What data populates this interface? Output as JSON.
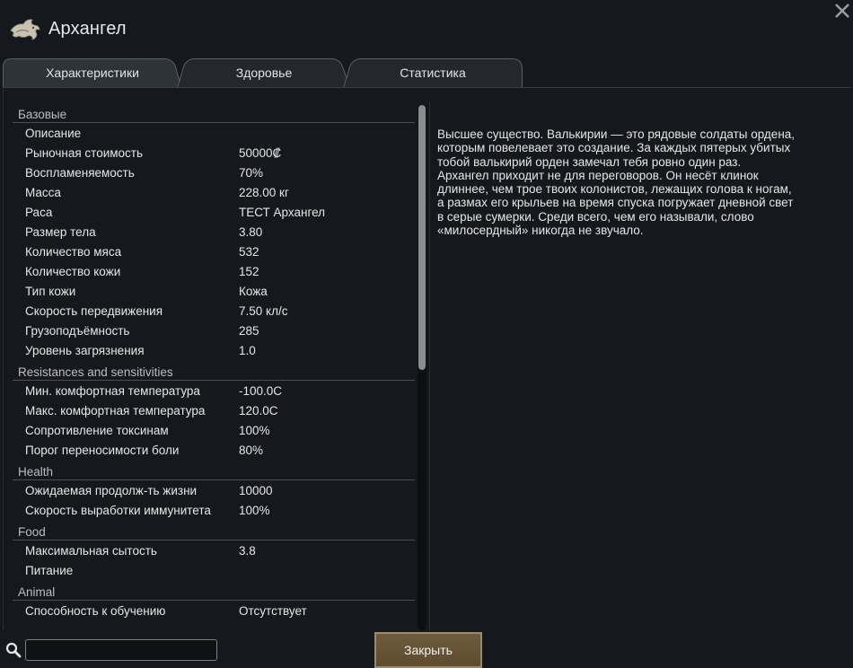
{
  "window": {
    "title": "Архангел",
    "header_icon": "creature-icon",
    "close_icon": "close-icon"
  },
  "tabs": [
    {
      "label": "Характеристики",
      "active": true
    },
    {
      "label": "Здоровье",
      "active": false
    },
    {
      "label": "Статистика",
      "active": false
    }
  ],
  "stats": [
    {
      "category": "Базовые",
      "rows": [
        {
          "label": "Описание",
          "value": ""
        },
        {
          "label": "Рыночная стоимость",
          "value": "50000₡"
        },
        {
          "label": "Воспламеняемость",
          "value": "70%"
        },
        {
          "label": "Масса",
          "value": "228.00 кг"
        },
        {
          "label": "Раса",
          "value": "ТЕСТ Архангел"
        },
        {
          "label": "Размер тела",
          "value": "3.80"
        },
        {
          "label": "Количество мяса",
          "value": "532"
        },
        {
          "label": "Количество кожи",
          "value": "152"
        },
        {
          "label": "Тип кожи",
          "value": "Кожа"
        },
        {
          "label": "Скорость передвижения",
          "value": "7.50 кл/с"
        },
        {
          "label": "Грузоподъёмность",
          "value": "285"
        },
        {
          "label": "Уровень загрязнения",
          "value": "1.0"
        }
      ]
    },
    {
      "category": "Resistances and sensitivities",
      "rows": [
        {
          "label": "Мин. комфортная температура",
          "value": "-100.0C"
        },
        {
          "label": "Макс. комфортная температура",
          "value": "120.0C"
        },
        {
          "label": "Сопротивление токсинам",
          "value": "100%"
        },
        {
          "label": "Порог переносимости боли",
          "value": "80%"
        }
      ]
    },
    {
      "category": "Health",
      "rows": [
        {
          "label": "Ожидаемая продолж-ть жизни",
          "value": "10000"
        },
        {
          "label": "Скорость выработки иммунитета",
          "value": "100%"
        }
      ]
    },
    {
      "category": "Food",
      "rows": [
        {
          "label": "Максимальная сытость",
          "value": "3.8"
        },
        {
          "label": "Питание",
          "value": ""
        }
      ]
    },
    {
      "category": "Animal",
      "rows": [
        {
          "label": "Способность к обучению",
          "value": "Отсутствует"
        }
      ]
    }
  ],
  "description_lines": [
    "Высшее существо. Валькирии — это рядовые солдаты ордена,",
    "которым повелевает это создание. За каждых пятерых убитых",
    "тобой валькирий орден замечал тебя ровно один раз.",
    "Архангел приходит не для переговоров. Он несёт клинок",
    "длиннее, чем трое твоих колонистов, лежащих голова к ногам,",
    "а размах его крыльев на время спуска погружает дневной свет",
    "в серые сумерки. Среди всего, чем его называли, слово",
    "«милосердный» никогда не звучало."
  ],
  "search": {
    "value": "",
    "icon": "search-icon"
  },
  "footer": {
    "close_label": "Закрыть"
  },
  "colors": {
    "background": "#15191d",
    "button": "#6e5a3c",
    "tab": "#24282c"
  }
}
